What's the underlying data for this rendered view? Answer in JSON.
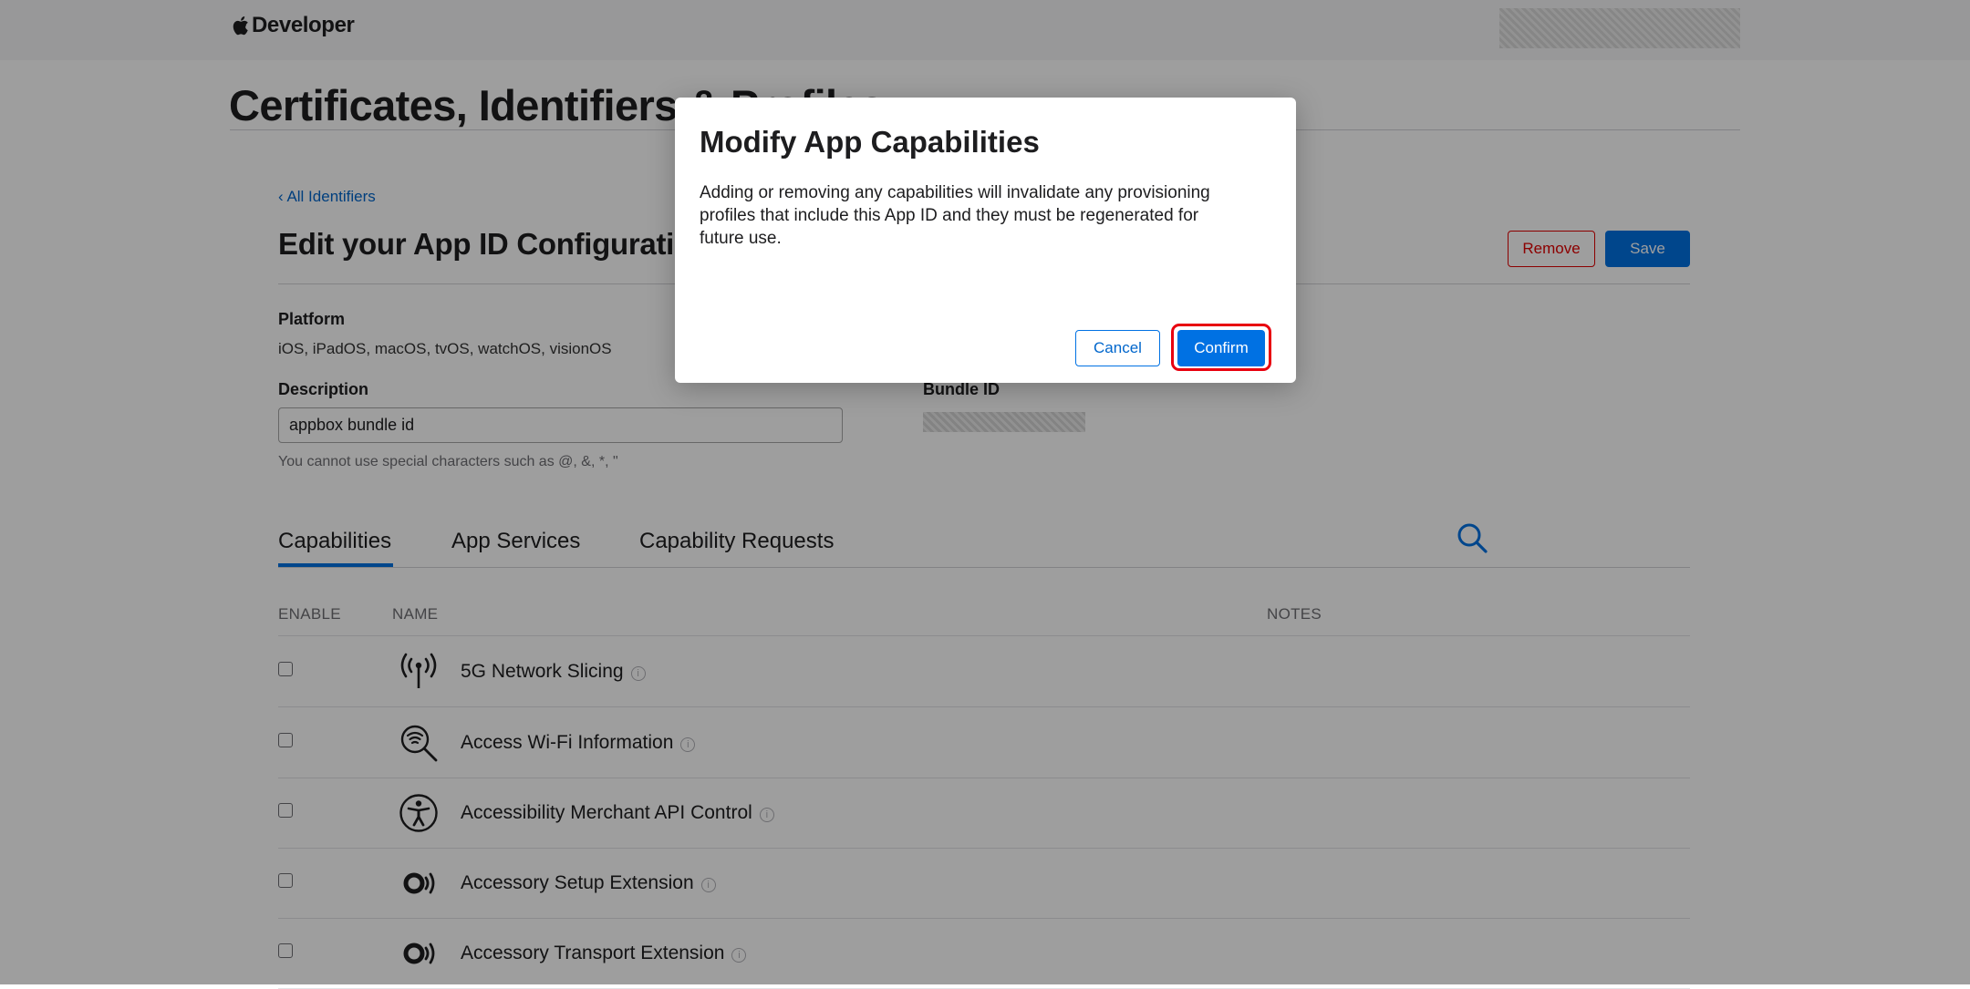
{
  "nav": {
    "brand_label": "Developer"
  },
  "page": {
    "title": "Certificates, Identifiers & Profiles"
  },
  "section": {
    "back_link": "‹ All Identifiers",
    "title": "Edit your App ID Configuration",
    "remove_label": "Remove",
    "save_label": "Save"
  },
  "form": {
    "platform_label": "Platform",
    "platform_value": "iOS, iPadOS, macOS, tvOS, watchOS, visionOS",
    "description_label": "Description",
    "description_value": "appbox bundle id",
    "description_help": "You cannot use special characters such as @, &, *, \"",
    "bundle_id_label": "Bundle ID"
  },
  "tabs": [
    {
      "label": "Capabilities",
      "active": true
    },
    {
      "label": "App Services",
      "active": false
    },
    {
      "label": "Capability Requests",
      "active": false
    }
  ],
  "table": {
    "headers": {
      "enable": "ENABLE",
      "name": "NAME",
      "notes": "NOTES"
    },
    "rows": [
      {
        "name": "5G Network Slicing",
        "icon": "antenna-icon",
        "enabled": false
      },
      {
        "name": "Access Wi-Fi Information",
        "icon": "wifi-search-icon",
        "enabled": false
      },
      {
        "name": "Accessibility Merchant API Control",
        "icon": "accessibility-icon",
        "enabled": false
      },
      {
        "name": "Accessory Setup Extension",
        "icon": "accessory-icon",
        "enabled": false
      },
      {
        "name": "Accessory Transport Extension",
        "icon": "accessory-icon",
        "enabled": false
      }
    ]
  },
  "modal": {
    "title": "Modify App Capabilities",
    "body": "Adding or removing any capabilities will invalidate any provisioning profiles that include this App ID and they must be regenerated for future use.",
    "cancel_label": "Cancel",
    "confirm_label": "Confirm"
  },
  "colors": {
    "accent": "#0071e3",
    "link": "#0066cc",
    "destructive": "#e30000",
    "highlight": "#e8000f"
  }
}
